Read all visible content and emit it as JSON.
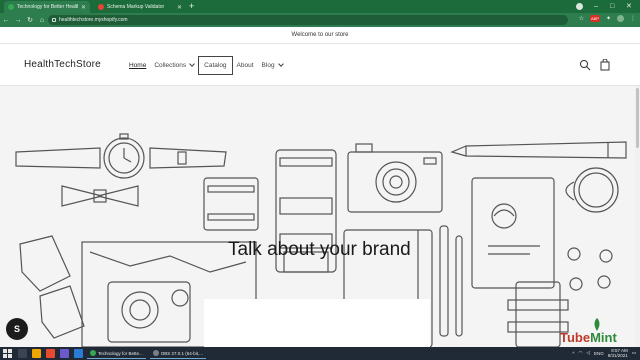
{
  "browser": {
    "tabs": [
      {
        "title": "Technology for Better Health | Hea",
        "active": true,
        "favicon_color": "#34a853"
      },
      {
        "title": "Schema Markup Validator",
        "active": false,
        "favicon_color": "#ea4335"
      }
    ],
    "new_tab": "+",
    "window_controls": {
      "minimize": "–",
      "maximize": "□",
      "close": "✕"
    },
    "nav": {
      "back": "←",
      "forward": "→",
      "reload": "↻",
      "home": "⌂"
    },
    "url": "healthtechstore.myshopify.com",
    "extension_badge": "ABP"
  },
  "announcement": "Welcome to our store",
  "store": {
    "name": "HealthTechStore",
    "menu": [
      {
        "label": "Home",
        "current": true
      },
      {
        "label": "Collections",
        "dropdown": true
      },
      {
        "label": "Catalog",
        "outlined": true
      },
      {
        "label": "About"
      },
      {
        "label": "Blog",
        "dropdown": true
      }
    ]
  },
  "hero": {
    "title": "Talk about your brand"
  },
  "shop_badge": "S",
  "watermark": {
    "part1": "Tube",
    "part2": "Mint"
  },
  "taskbar": {
    "apps": [
      {
        "label": "Technology for Bette...",
        "color": "#34a853"
      },
      {
        "label": "OBS 27.0.1 (64-bit,...",
        "color": "#444b57"
      }
    ],
    "language": "ENG",
    "time": "8:57 AM",
    "date": "8/31/2021"
  },
  "colors": {
    "browser_chrome": "#2e7d4f",
    "hero_background": "#f4f4f4",
    "line_art": "#555555"
  }
}
